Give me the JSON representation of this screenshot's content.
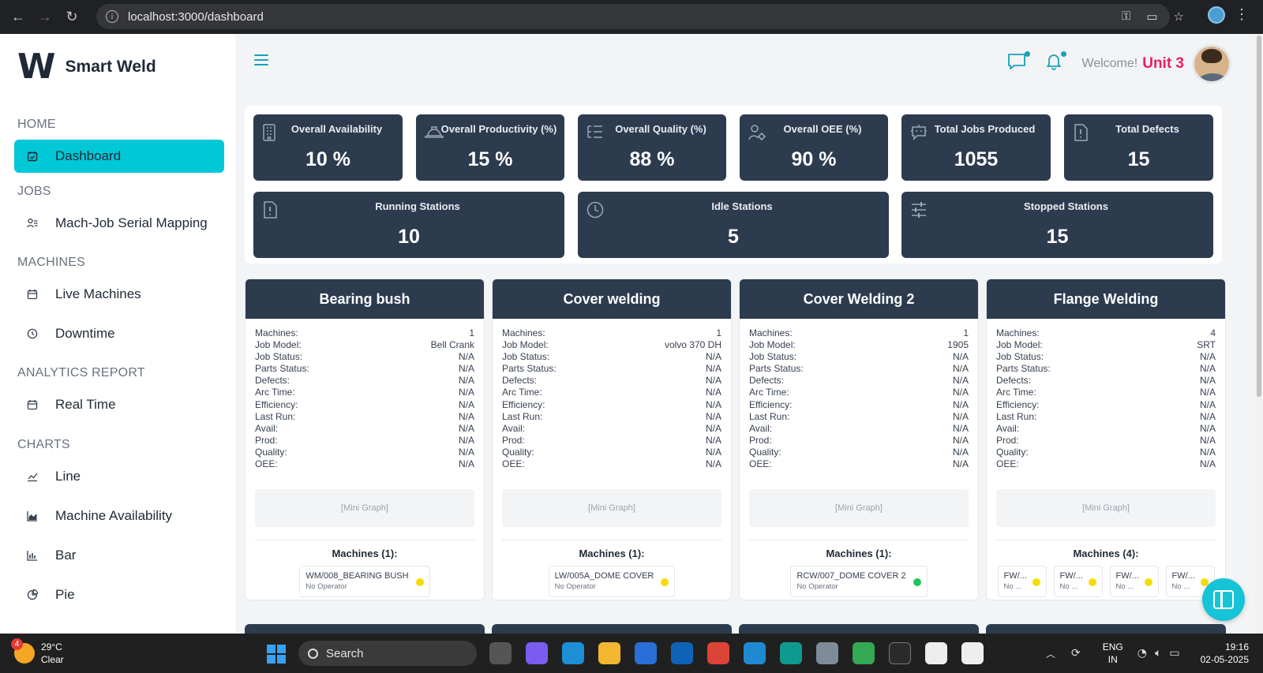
{
  "browser": {
    "url": "localhost:3000/dashboard"
  },
  "brand": {
    "logo": "W",
    "name": "Smart Weld"
  },
  "sidebar": {
    "sections": [
      {
        "title": "HOME",
        "items": [
          {
            "label": "Dashboard",
            "icon": "calendar-check-icon",
            "active": true
          }
        ]
      },
      {
        "title": "JOBS",
        "items": [
          {
            "label": "Mach-Job Serial Mapping",
            "icon": "user-list-icon"
          }
        ]
      },
      {
        "title": "MACHINES",
        "items": [
          {
            "label": "Live Machines",
            "icon": "calendar-icon"
          },
          {
            "label": "Downtime",
            "icon": "clock-icon"
          }
        ]
      },
      {
        "title": "ANALYTICS REPORT",
        "items": [
          {
            "label": "Real Time",
            "icon": "calendar-icon"
          }
        ]
      },
      {
        "title": "CHARTS",
        "items": [
          {
            "label": "Line",
            "icon": "line-chart-icon"
          },
          {
            "label": "Machine Availability",
            "icon": "area-chart-icon"
          },
          {
            "label": "Bar",
            "icon": "bar-chart-icon"
          },
          {
            "label": "Pie",
            "icon": "pie-chart-icon"
          }
        ]
      }
    ]
  },
  "header": {
    "welcome": "Welcome!",
    "user": "Unit 3"
  },
  "kpis": {
    "availability": {
      "label": "Overall Availability",
      "value": "10 %"
    },
    "productivity": {
      "label": "Overall Productivity (%)",
      "value": "15 %"
    },
    "quality": {
      "label": "Overall Quality (%)",
      "value": "88 %"
    },
    "oee": {
      "label": "Overall OEE (%)",
      "value": "90 %"
    },
    "jobs": {
      "label": "Total Jobs Produced",
      "value": "1055"
    },
    "defects": {
      "label": "Total Defects",
      "value": "15"
    },
    "running": {
      "label": "Running Stations",
      "value": "10"
    },
    "idle": {
      "label": "Idle Stations",
      "value": "5"
    },
    "stopped": {
      "label": "Stopped Stations",
      "value": "15"
    }
  },
  "row_labels": [
    "Machines:",
    "Job Model:",
    "Job Status:",
    "Parts Status:",
    "Defects:",
    "Arc Time:",
    "Efficiency:",
    "Last Run:",
    "Avail:",
    "Prod:",
    "Quality:",
    "OEE:"
  ],
  "mini_graph": "[Mini Graph]",
  "stations": [
    {
      "name": "Bearing bush",
      "values": [
        "1",
        "Bell Crank",
        "N/A",
        "N/A",
        "N/A",
        "N/A",
        "N/A",
        "N/A",
        "N/A",
        "N/A",
        "N/A",
        "N/A"
      ],
      "machines_title": "Machines (1):",
      "machines": [
        {
          "name": "WM/008_BEARING BUSH",
          "operator": "No Operator",
          "status_color": "#f5dc00"
        }
      ]
    },
    {
      "name": "Cover welding",
      "values": [
        "1",
        "volvo 370 DH",
        "N/A",
        "N/A",
        "N/A",
        "N/A",
        "N/A",
        "N/A",
        "N/A",
        "N/A",
        "N/A",
        "N/A"
      ],
      "machines_title": "Machines (1):",
      "machines": [
        {
          "name": "LW/005A_DOME COVER",
          "operator": "No Operator",
          "status_color": "#f5dc00"
        }
      ]
    },
    {
      "name": "Cover Welding 2",
      "values": [
        "1",
        "1905",
        "N/A",
        "N/A",
        "N/A",
        "N/A",
        "N/A",
        "N/A",
        "N/A",
        "N/A",
        "N/A",
        "N/A"
      ],
      "machines_title": "Machines (1):",
      "machines": [
        {
          "name": "RCW/007_DOME COVER 2",
          "operator": "No Operator",
          "status_color": "#22c55e"
        }
      ]
    },
    {
      "name": "Flange Welding",
      "values": [
        "4",
        "SRT",
        "N/A",
        "N/A",
        "N/A",
        "N/A",
        "N/A",
        "N/A",
        "N/A",
        "N/A",
        "N/A",
        "N/A"
      ],
      "machines_title": "Machines (4):",
      "machines": [
        {
          "name": "FW/...",
          "operator": "No ...",
          "status_color": "#f5dc00"
        },
        {
          "name": "FW/...",
          "operator": "No ...",
          "status_color": "#f5dc00"
        },
        {
          "name": "FW/...",
          "operator": "No ...",
          "status_color": "#f5dc00"
        },
        {
          "name": "FW/...",
          "operator": "No ...",
          "status_color": "#f5dc00"
        }
      ]
    }
  ],
  "taskbar": {
    "weather_temp": "29°C",
    "weather_desc": "Clear",
    "weather_badge": "4",
    "search": "Search",
    "lang_1": "ENG",
    "lang_2": "IN",
    "time": "19:16",
    "date": "02-05-2025"
  },
  "colors": {
    "accent": "#00c8d7",
    "card_header": "#2d3b4f",
    "user_name": "#e91e63"
  }
}
